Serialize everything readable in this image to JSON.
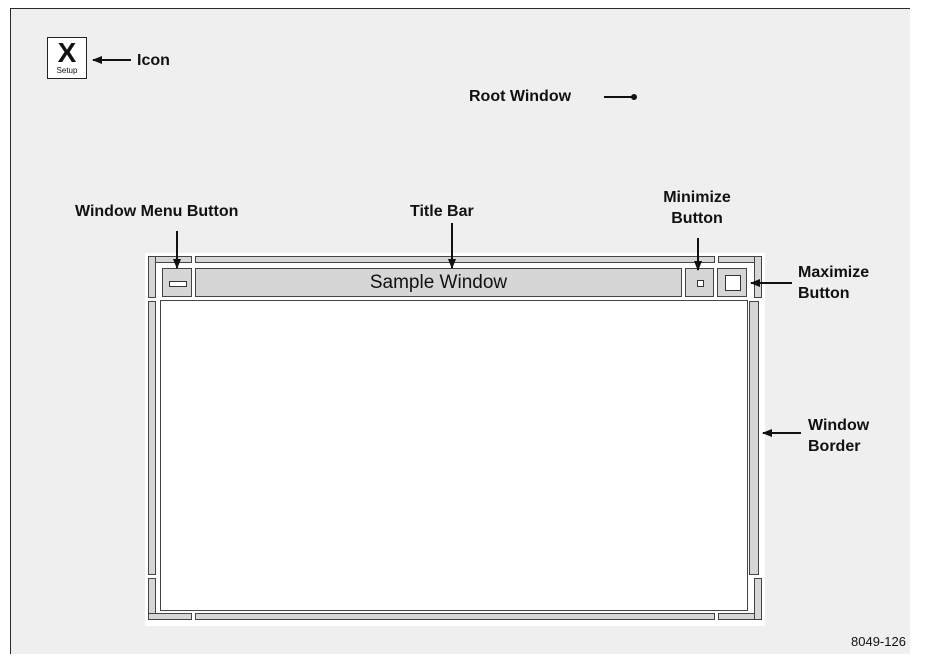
{
  "icon": {
    "glyph": "X",
    "caption": "Setup"
  },
  "labels": {
    "icon": "Icon",
    "root_window": "Root Window",
    "window_menu_button": "Window Menu Button",
    "title_bar": "Title Bar",
    "minimize_line1": "Minimize",
    "minimize_line2": "Button",
    "maximize_line1": "Maximize",
    "maximize_line2": "Button",
    "border_line1": "Window",
    "border_line2": "Border"
  },
  "window": {
    "title": "Sample Window"
  },
  "figure_id": "8049-126"
}
